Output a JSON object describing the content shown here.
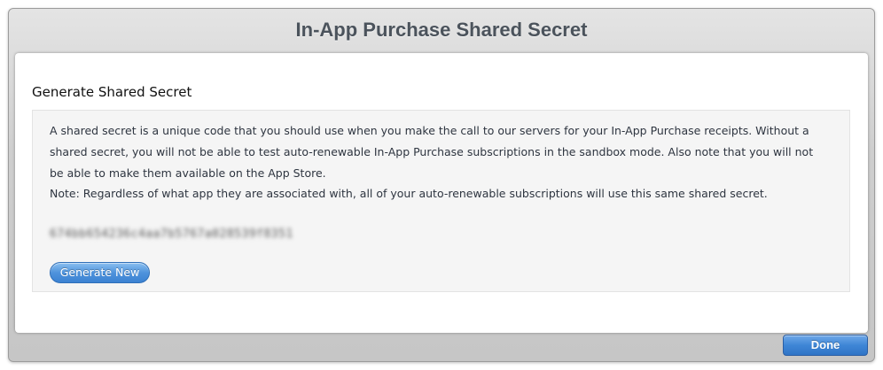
{
  "dialog": {
    "title": "In-App Purchase Shared Secret",
    "done_label": "Done"
  },
  "section": {
    "heading": "Generate Shared Secret",
    "description": "A shared secret is a unique code that you should use when you make the call to our servers for your In-App Purchase receipts. Without a shared secret, you will not be able to test auto-renewable In-App Purchase subscriptions in the sandbox mode. Also note that you will not be able to make them available on the App Store.",
    "note": "Note: Regardless of what app they are associated with, all of your auto-renewable subscriptions will use this same shared secret.",
    "secret_value": "674bb654236c4aa7b5767a028539f8351",
    "generate_label": "Generate New"
  },
  "colors": {
    "title_text": "#4b535c",
    "button_blue": "#3f86d6",
    "dialog_gray": "#cfcfcf",
    "panel_bg": "#ffffff",
    "info_bg": "#f5f5f5"
  }
}
